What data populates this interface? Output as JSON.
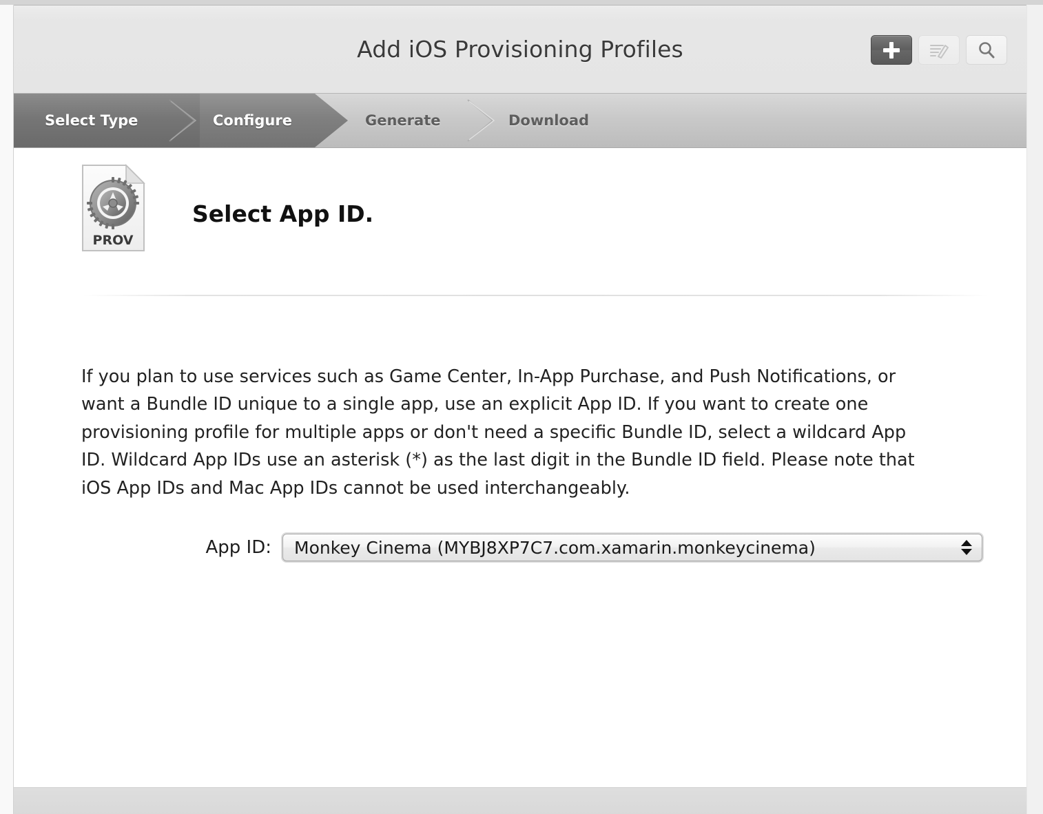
{
  "window": {
    "title": "Add iOS Provisioning Profiles"
  },
  "toolbar": {
    "buttons": [
      {
        "name": "add",
        "icon": "plus-icon",
        "state": "selected",
        "label": "+"
      },
      {
        "name": "edit",
        "icon": "edit-pencil-icon",
        "state": "disabled",
        "label": ""
      },
      {
        "name": "search",
        "icon": "search-magnifier-icon",
        "state": "normal",
        "label": ""
      }
    ]
  },
  "steps": [
    {
      "label": "Select Type",
      "state": "done"
    },
    {
      "label": "Configure",
      "state": "active"
    },
    {
      "label": "Generate",
      "state": "pending"
    },
    {
      "label": "Download",
      "state": "pending"
    }
  ],
  "content": {
    "icon": {
      "name": "prov-document-icon",
      "caption": "PROV"
    },
    "heading": "Select App ID.",
    "body": "If you plan to use services such as Game Center, In-App Purchase, and Push Notifications, or want a Bundle ID unique to a single app, use an explicit App ID. If you want to create one provisioning profile for multiple apps or don't need a specific Bundle ID, select a wildcard App ID. Wildcard App IDs use an asterisk (*) as the last digit in the Bundle ID field. Please note that iOS App IDs and Mac App IDs cannot be used interchangeably.",
    "field": {
      "label": "App ID:",
      "value": "Monkey Cinema (MYBJ8XP7C7.com.xamarin.monkeycinema)"
    }
  },
  "colors": {
    "titlebar_bg": "#e6e6e6",
    "step_done_bg": "#767676",
    "step_active_bg": "#808080",
    "step_pending_bg": "#c9c9c9",
    "step_pending_text": "#5e5e5e",
    "content_bg": "#ffffff",
    "footer_bg": "#d9d9d9"
  }
}
